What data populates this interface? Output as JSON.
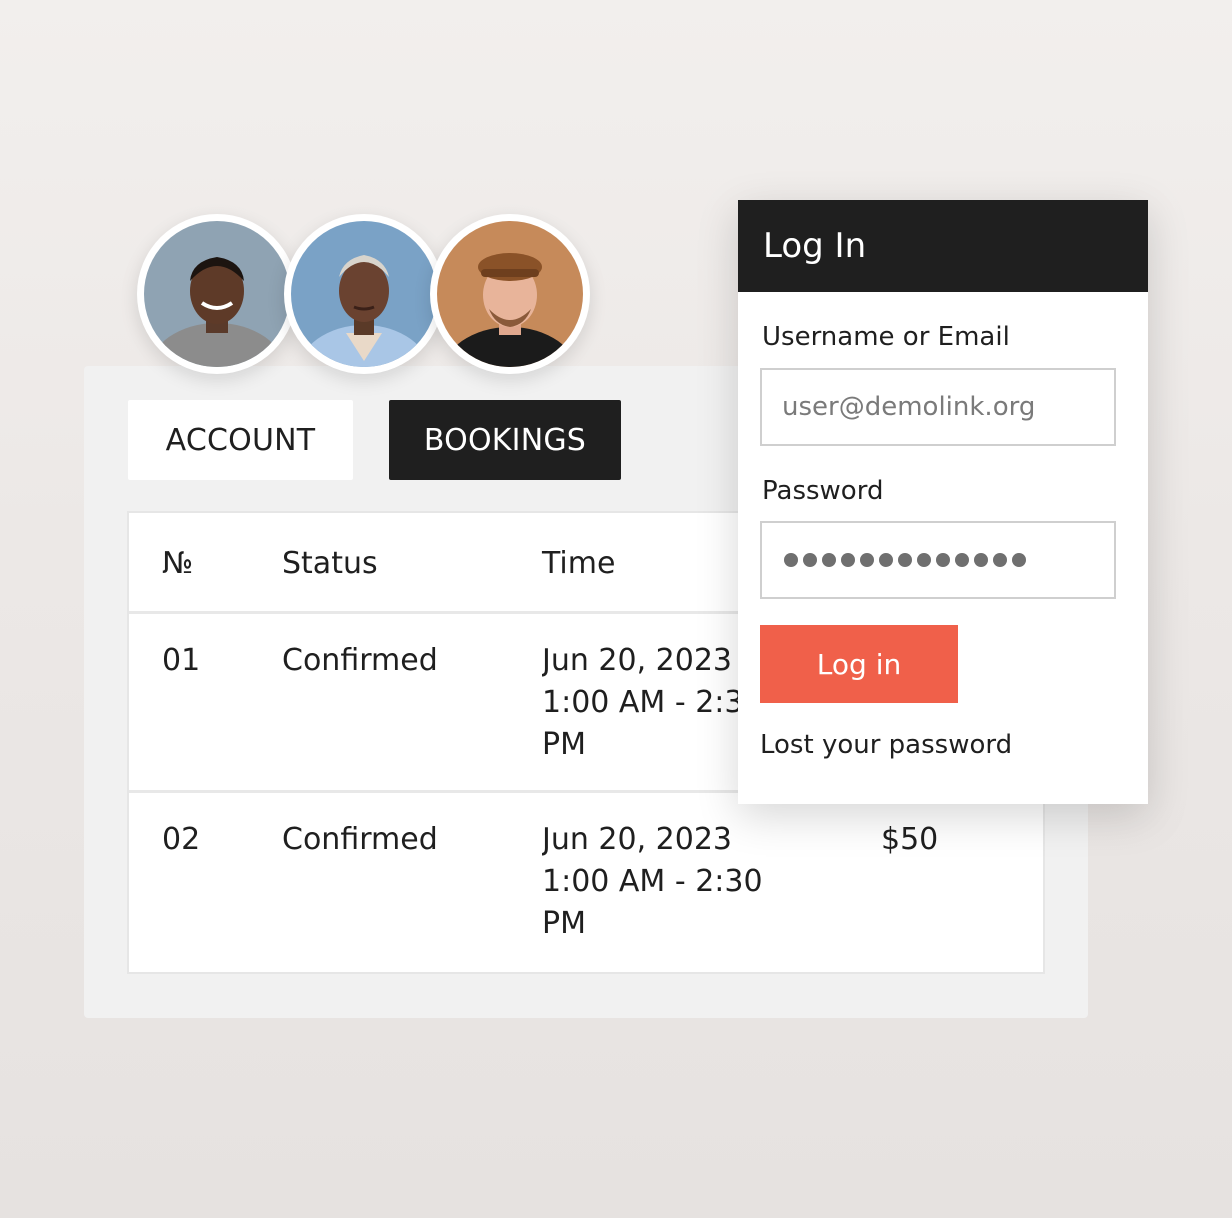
{
  "tabs": {
    "account_label": "ACCOUNT",
    "bookings_label": "BOOKINGS",
    "active": "BOOKINGS"
  },
  "table": {
    "headers": {
      "number": "№",
      "status": "Status",
      "time": "Time"
    },
    "rows": [
      {
        "number": "01",
        "status": "Confirmed",
        "time": "Jun 20, 2023 1:00 AM - 2:30 PM",
        "price": ""
      },
      {
        "number": "02",
        "status": "Confirmed",
        "time": "Jun 20, 2023 1:00 AM - 2:30 PM",
        "price": "$50"
      }
    ]
  },
  "avatars": [
    {
      "description": "man-grey-sweater"
    },
    {
      "description": "woman-blue-blazer"
    },
    {
      "description": "man-brown-cap"
    }
  ],
  "login": {
    "title": "Log In",
    "username_label": "Username or Email",
    "username_placeholder": "user@demolink.org",
    "password_label": "Password",
    "password_mask_length": 13,
    "submit_label": "Log in",
    "lost_password_label": "Lost your password"
  },
  "colors": {
    "dark": "#1f1f1f",
    "accent": "#f0604a",
    "panel": "#f1f1f1"
  }
}
